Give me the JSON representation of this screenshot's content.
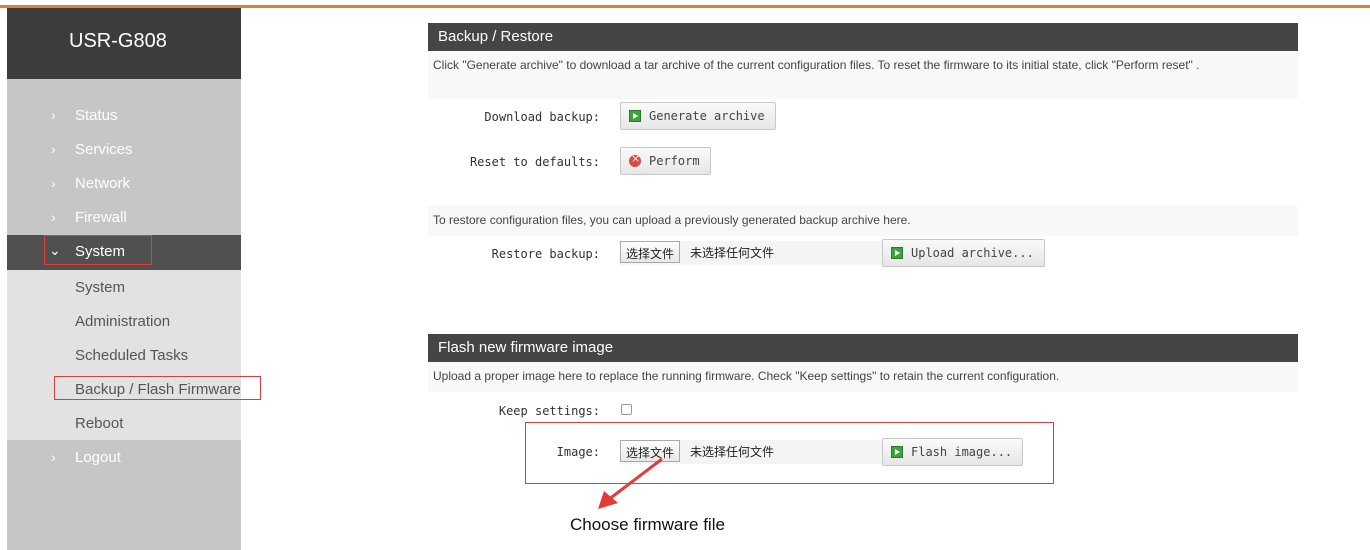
{
  "brand": "USR-G808",
  "nav": {
    "status": "Status",
    "services": "Services",
    "network": "Network",
    "firewall": "Firewall",
    "system": "System",
    "logout": "Logout",
    "sub": {
      "system": "System",
      "administration": "Administration",
      "scheduled_tasks": "Scheduled Tasks",
      "backup_flash": "Backup / Flash Firmware",
      "reboot": "Reboot"
    }
  },
  "backup": {
    "title": "Backup / Restore",
    "description": "Click \"Generate archive\" to download a tar archive of the current configuration files. To reset the firmware to its initial state, click \"Perform reset\" .",
    "download_label": "Download backup:",
    "generate_button": "Generate archive",
    "reset_label": "Reset to defaults:",
    "perform_button": "Perform",
    "restore_description": "To restore configuration files, you can upload a previously generated backup archive here.",
    "restore_label": "Restore backup:",
    "choose_file": "选择文件",
    "no_file": "未选择任何文件",
    "upload_button": "Upload archive..."
  },
  "flash": {
    "title": "Flash new firmware image",
    "description": "Upload a proper image here to replace the running firmware. Check \"Keep settings\" to retain the current configuration.",
    "keep_label": "Keep settings:",
    "keep_checked": false,
    "image_label": "Image:",
    "choose_file": "选择文件",
    "no_file": "未选择任何文件",
    "flash_button": "Flash image..."
  },
  "annotation": "Choose firmware file",
  "colors": {
    "accent_line": "#e0822a",
    "highlight_box": "#e33b3b",
    "header_bg": "#454545",
    "sidebar_dark": "#3c3c3c"
  }
}
